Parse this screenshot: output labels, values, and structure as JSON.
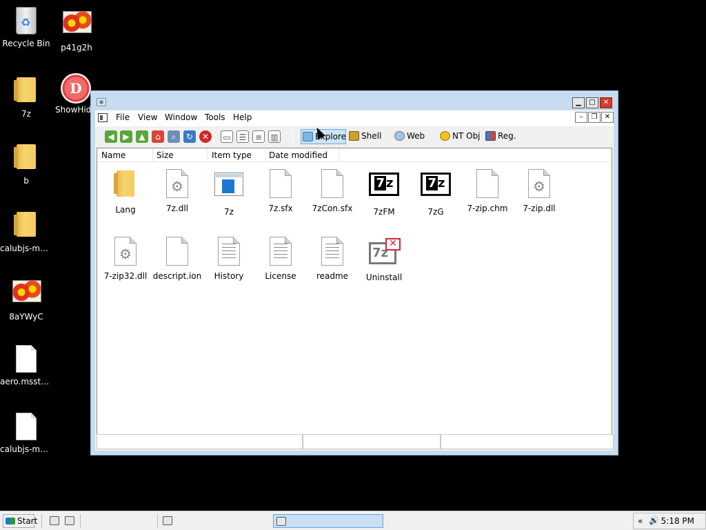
{
  "desktop": {
    "icons": [
      {
        "label": "Recycle Bin"
      },
      {
        "label": "p41g2h"
      },
      {
        "label": "7z"
      },
      {
        "label": "ShowHid"
      },
      {
        "label": "b"
      },
      {
        "label": "calubjs-main"
      },
      {
        "label": "8aYWyC"
      },
      {
        "label": "aero.msstyles"
      },
      {
        "label": "calubjs-ma..."
      }
    ],
    "showhide_glyph": "D"
  },
  "window": {
    "controls": {
      "minimize": "▁",
      "maximize": "□",
      "close": "✕"
    },
    "mdi_controls": {
      "minimize": "–",
      "restore": "❐",
      "close": "✕"
    },
    "menu": [
      "File",
      "View",
      "Window",
      "Tools",
      "Help"
    ],
    "toolbar": {
      "nav_icons": [
        "back-icon",
        "forward-icon",
        "up-icon",
        "home-icon",
        "search-icon",
        "refresh-icon",
        "stop-icon"
      ],
      "view_icons": [
        "large-icons-view-icon",
        "small-icons-view-icon",
        "list-view-icon",
        "details-view-icon"
      ],
      "tabs": [
        {
          "label": "Explore",
          "active": true
        },
        {
          "label": "Shell",
          "active": false
        },
        {
          "label": "Web",
          "active": false
        },
        {
          "label": "NT Obj",
          "active": false
        },
        {
          "label": "Reg.",
          "active": false
        }
      ]
    },
    "columns": [
      "Name",
      "Size",
      "Item type",
      "Date modified"
    ],
    "files": [
      {
        "name": "Lang",
        "kind": "folder"
      },
      {
        "name": "7z.dll",
        "kind": "dll"
      },
      {
        "name": "7z",
        "kind": "app"
      },
      {
        "name": "7z.sfx",
        "kind": "blank"
      },
      {
        "name": "7zCon.sfx",
        "kind": "blank"
      },
      {
        "name": "7zFM",
        "kind": "7z"
      },
      {
        "name": "7zG",
        "kind": "7z"
      },
      {
        "name": "7-zip.chm",
        "kind": "blank"
      },
      {
        "name": "7-zip.dll",
        "kind": "dll"
      },
      {
        "name": "7-zip32.dll",
        "kind": "dll"
      },
      {
        "name": "descript.ion",
        "kind": "blank"
      },
      {
        "name": "History",
        "kind": "text"
      },
      {
        "name": "License",
        "kind": "text"
      },
      {
        "name": "readme",
        "kind": "text"
      },
      {
        "name": "Uninstall",
        "kind": "uninstall"
      }
    ],
    "sevenz_glyph": "7z"
  },
  "taskbar": {
    "start_label": "Start",
    "tray": {
      "chevron": "«",
      "volume": "🔊",
      "clock": "5:18 PM"
    }
  }
}
